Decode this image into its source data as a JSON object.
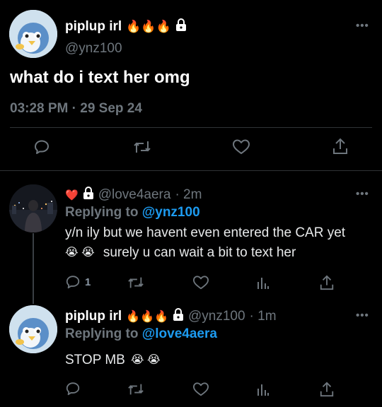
{
  "main_tweet": {
    "display_name": "piplup irl",
    "name_emojis": "🔥🔥🔥",
    "handle": "@ynz100",
    "text": "what do i text her omg",
    "timestamp": "03:28 PM · 29 Sep 24"
  },
  "reply1": {
    "heart": "❤️",
    "handle": "@love4aera",
    "time": "· 2m",
    "replying_prefix": "Replying to ",
    "replying_to": "@ynz100",
    "text_line1": "y/n ily but we havent even entered the CAR yet",
    "text_line2_emojis": "😭 😭",
    "text_line2": "surely u can wait a bit to text her",
    "reply_count": "1"
  },
  "reply2": {
    "display_name": "piplup irl",
    "name_emojis": "🔥🔥🔥",
    "handle": "@ynz100",
    "time": "· 1m",
    "replying_prefix": "Replying to ",
    "replying_to": "@love4aera",
    "text": "STOP MB",
    "text_emojis": "😭 😭"
  },
  "more_label": "•••",
  "colors": {
    "background": "#000000",
    "text": "#e7e9ea",
    "muted": "#6e767d",
    "link": "#1d9bf0",
    "divider": "#2f3336"
  },
  "icons": [
    "reply-icon",
    "retweet-icon",
    "like-icon",
    "share-icon",
    "analytics-icon",
    "lock-icon"
  ]
}
